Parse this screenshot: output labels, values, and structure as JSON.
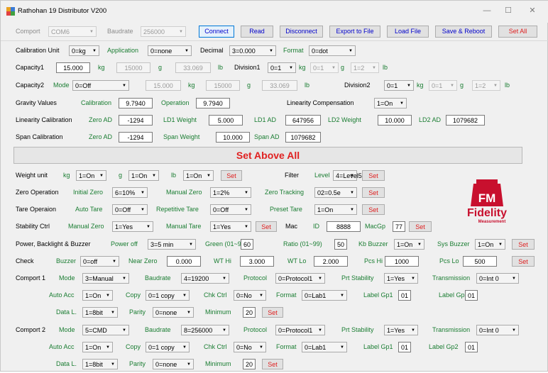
{
  "window": {
    "title": "Rathohan 19 Distributor V200",
    "minimize": "—",
    "maximize": "☐",
    "close": "✕"
  },
  "toolbar": {
    "comport_label": "Comport",
    "comport_value": "COM6",
    "baudrate_label": "Baudrate",
    "baudrate_value": "256000",
    "connect": "Connect",
    "read": "Read",
    "disconnect": "Disconnect",
    "export": "Export to File",
    "load": "Load File",
    "save_reboot": "Save & Reboot",
    "set_all": "Set All"
  },
  "calibration_unit": {
    "label": "Calibration Unit",
    "unit": "0=kg",
    "application_label": "Application",
    "application": "0=none",
    "decimal_label": "Decimal",
    "decimal": "3=0.000",
    "format_label": "Format",
    "format": "0=dot"
  },
  "capacity1": {
    "label": "Capacity1",
    "value": "15.000",
    "unit1": "kg",
    "value2": "15000",
    "unit2": "g",
    "value3": "33.069",
    "unit3": "lb",
    "division_label": "Division1",
    "div_kg": "0=1",
    "unit_kg": "kg",
    "div_g": "0=1",
    "unit_g": "g",
    "div_lb": "1=2",
    "unit_lb": "lb"
  },
  "capacity2": {
    "label": "Capacity2",
    "mode_label": "Mode",
    "mode": "0=Off",
    "value": "15.000",
    "unit1": "kg",
    "value2": "15000",
    "unit2": "g",
    "value3": "33.069",
    "unit3": "lb",
    "division_label": "Division2",
    "div_kg": "0=1",
    "unit_kg": "kg",
    "div_g": "0=1",
    "unit_g": "g",
    "div_lb": "1=2",
    "unit_lb": "lb"
  },
  "gravity": {
    "label": "Gravity Values",
    "calibration_label": "Calibration",
    "calibration": "9.7940",
    "operation_label": "Operation",
    "operation": "9.7940",
    "linearity_label": "Linearity Compensation",
    "linearity": "1=On"
  },
  "linearity": {
    "label": "Linearity Calibration",
    "zero_ad_label": "Zero AD",
    "zero_ad": "-1294",
    "ld1_weight_label": "LD1 Weight",
    "ld1_weight": "5.000",
    "ld1_ad_label": "LD1 AD",
    "ld1_ad": "647956",
    "ld2_weight_label": "LD2 Weight",
    "ld2_weight": "10.000",
    "ld2_ad_label": "LD2 AD",
    "ld2_ad": "1079682"
  },
  "span": {
    "label": "Span Calibration",
    "zero_ad_label": "Zero AD",
    "zero_ad": "-1294",
    "weight_label": "Span Weight",
    "weight": "10.000",
    "ad_label": "Span AD",
    "ad": "1079682"
  },
  "set_above_all": "Set Above All",
  "weight_unit": {
    "label": "Weight unit",
    "kg_label": "kg",
    "kg": "1=On",
    "g_label": "g",
    "g": "1=On",
    "lb_label": "lb",
    "lb": "1=On",
    "set": "Set",
    "filter_label": "Filter",
    "level_label": "Level",
    "level": "4=Level5",
    "set2": "Set"
  },
  "zero_op": {
    "label": "Zero Operation",
    "initial_label": "Initial Zero",
    "initial": "6=10%",
    "manual_label": "Manual Zero",
    "manual": "1=2%",
    "tracking_label": "Zero Tracking",
    "tracking": "02=0.5e",
    "set": "Set"
  },
  "tare": {
    "label": "Tare Operaion",
    "auto_label": "Auto Tare",
    "auto": "0=Off",
    "repetitive_label": "Repetitive Tare",
    "repetitive": "0=Off",
    "preset_label": "Preset Tare",
    "preset": "1=On",
    "set": "Set"
  },
  "stability": {
    "label": "Stability Ctrl",
    "manual_zero_label": "Manual Zero",
    "manual_zero": "1=Yes",
    "manual_tare_label": "Manual Tare",
    "manual_tare": "1=Yes",
    "set": "Set",
    "mac_label": "Mac",
    "id_label": "ID",
    "id": "8888",
    "macgp_label": "MacGp",
    "macgp": "77",
    "set2": "Set"
  },
  "power": {
    "label": "Power, Backlight & Buzzer",
    "poweroff_label": "Power off",
    "poweroff": "3=5 min",
    "green_label": "Green (01~99)",
    "green": "60",
    "ratio_label": "Ratio (01~99)",
    "ratio": "50",
    "kb_label": "Kb Buzzer",
    "kb": "1=On",
    "sys_label": "Sys Buzzer",
    "sys": "1=On",
    "set": "Set"
  },
  "check": {
    "label": "Check",
    "buzzer_label": "Buzzer",
    "buzzer": "0=off",
    "near_label": "Near Zero",
    "near": "0.000",
    "wthi_label": "WT Hi",
    "wthi": "3.000",
    "wtlo_label": "WT Lo",
    "wtlo": "2.000",
    "pcshi_label": "Pcs Hi",
    "pcshi": "1000",
    "pcslo_label": "Pcs Lo",
    "pcslo": "500",
    "set": "Set"
  },
  "comport1": {
    "label": "Comport 1",
    "mode_label": "Mode",
    "mode": "3=Manual",
    "baud_label": "Baudrate",
    "baud": "4=19200",
    "protocol_label": "Protocol",
    "protocol": "0=Protocol1",
    "prt_label": "Prt Stability",
    "prt": "1=Yes",
    "trans_label": "Transmission",
    "trans": "0=Int 0",
    "autoacc_label": "Auto Acc",
    "autoacc": "1=On",
    "copy_label": "Copy",
    "copy": "0=1 copy",
    "chk_label": "Chk Ctrl",
    "chk": "0=No",
    "format_label": "Format",
    "format": "0=Lab1",
    "gp1_label": "Label Gp1",
    "gp1": "01",
    "gp2_label": "Label Gp2",
    "gp2": "01",
    "datal_label": "Data L.",
    "datal": "1=8bit",
    "parity_label": "Parity",
    "parity": "0=none",
    "min_label": "Minimum",
    "min": "20",
    "set": "Set"
  },
  "comport2": {
    "label": "Comport 2",
    "mode_label": "Mode",
    "mode": "5=CMD",
    "baud_label": "Baudrate",
    "baud": "8=256000",
    "protocol_label": "Protocol",
    "protocol": "0=Protocol1",
    "prt_label": "Prt Stability",
    "prt": "1=Yes",
    "trans_label": "Transmission",
    "trans": "0=Int 0",
    "autoacc_label": "Auto Acc",
    "autoacc": "1=On",
    "copy_label": "Copy",
    "copy": "0=1 copy",
    "chk_label": "Chk Ctrl",
    "chk": "0=No",
    "format_label": "Format",
    "format": "0=Lab1",
    "gp1_label": "Label Gp1",
    "gp1": "01",
    "gp2_label": "Label Gp2",
    "gp2": "01",
    "datal_label": "Data L.",
    "datal": "1=8bit",
    "parity_label": "Parity",
    "parity": "0=none",
    "min_label": "Minimum",
    "min": "20",
    "set": "Set"
  },
  "logo": {
    "mark": "FM",
    "name": "Fidelity",
    "sub": "Measurement",
    "color": "#c8102e"
  }
}
